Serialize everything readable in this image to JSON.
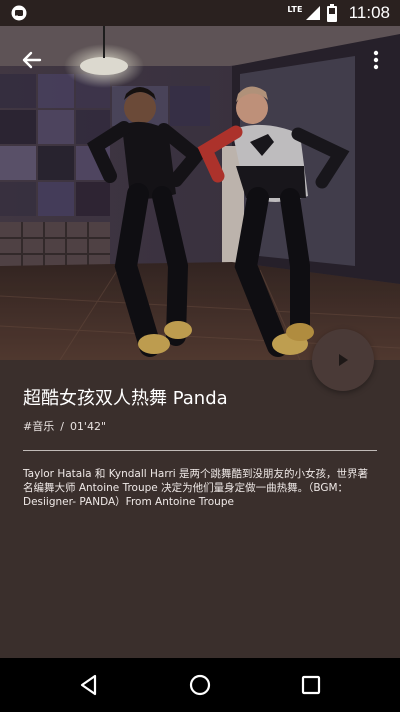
{
  "status_bar": {
    "network_label": "LTE",
    "time": "11:08",
    "icons": [
      "notification-icon",
      "signal-icon",
      "battery-icon"
    ]
  },
  "toolbar": {
    "back_icon": "arrow-back-icon",
    "overflow_icon": "more-vert-icon"
  },
  "video": {
    "play_icon": "play-icon"
  },
  "detail": {
    "title": "超酷女孩双人热舞 Panda",
    "category": "#音乐",
    "separator": "/",
    "duration": "01'42\"",
    "description": "Taylor Hatala 和 Kyndall Harri 是两个跳舞酷到没朋友的小女孩，世界著名编舞大师 Antoine Troupe 决定为他们量身定做一曲热舞。（BGM：Desiigner- PANDA）From Antoine Troupe"
  },
  "nav": {
    "icons": [
      "back-triangle-icon",
      "home-circle-icon",
      "recents-square-icon"
    ]
  },
  "colors": {
    "background": "#3a2f2c",
    "fab": "#4a3a37",
    "statusbar": "#2a211f"
  }
}
